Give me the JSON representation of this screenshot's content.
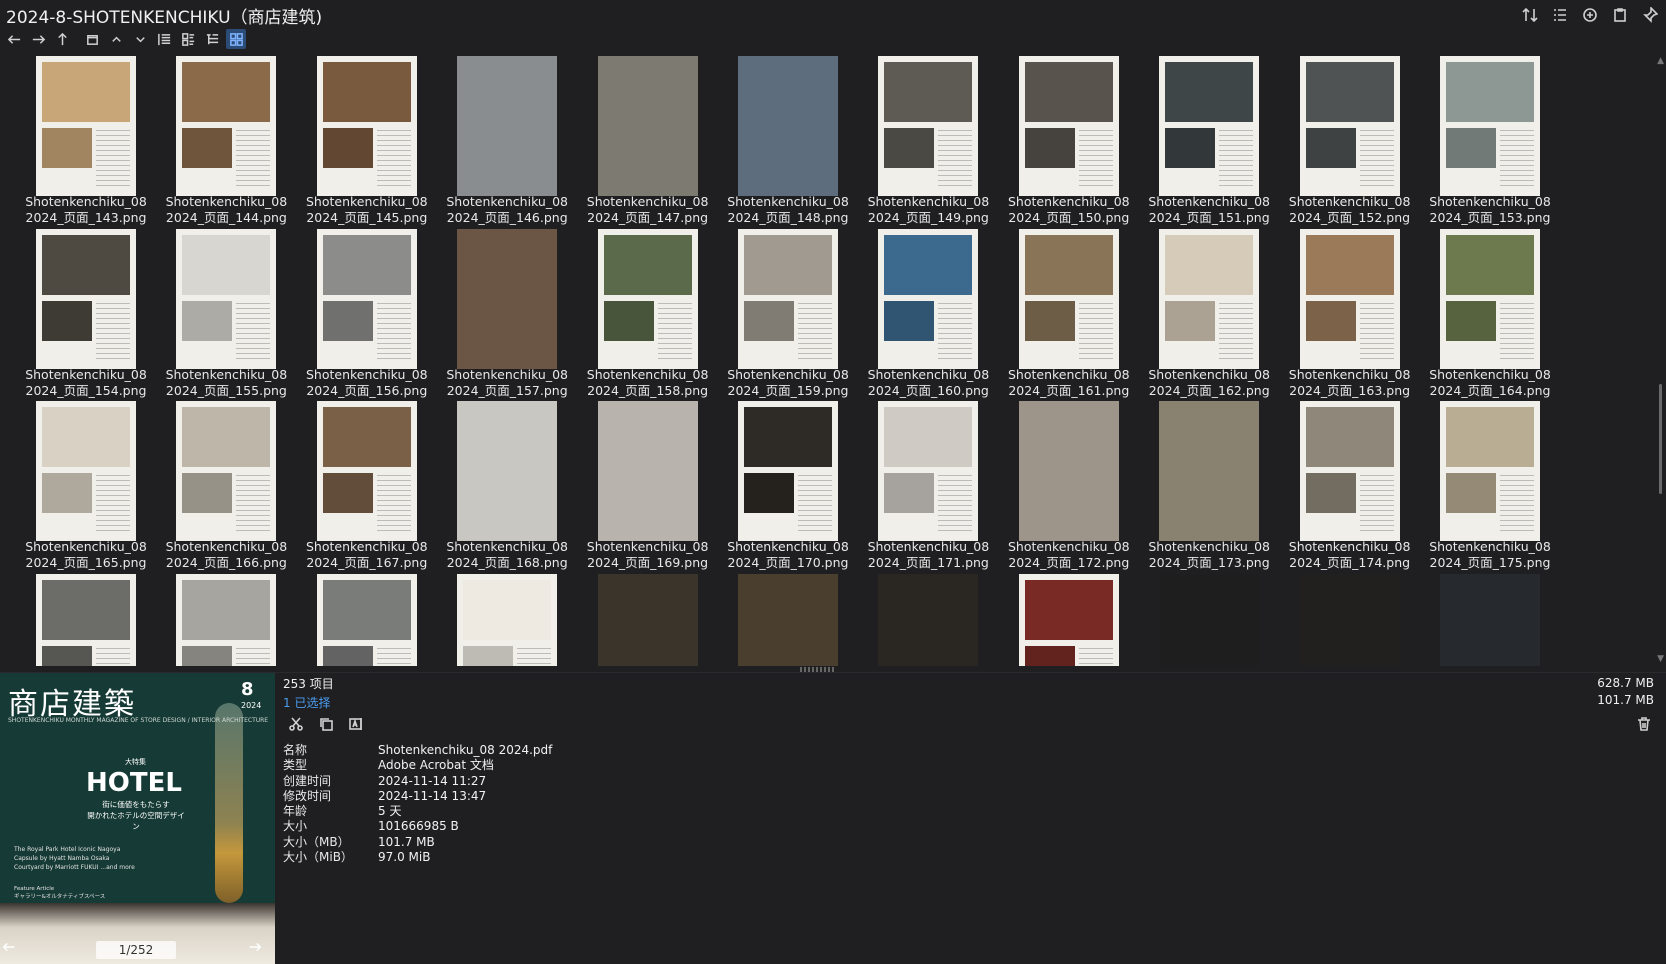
{
  "window": {
    "title": "2024-8-SHOTENKENCHIKU（商店建筑)"
  },
  "top_actions": [
    {
      "name": "sort-icon"
    },
    {
      "name": "list-view-icon"
    },
    {
      "name": "add-icon"
    },
    {
      "name": "clipboard-icon"
    },
    {
      "name": "pin-icon"
    }
  ],
  "toolbar": [
    {
      "name": "back-icon"
    },
    {
      "name": "forward-icon"
    },
    {
      "name": "up-icon"
    },
    {
      "name": "window-icon"
    },
    {
      "name": "sort-up-icon"
    },
    {
      "name": "sort-down-icon"
    },
    {
      "name": "detail-list-icon"
    },
    {
      "name": "tiles-icon"
    },
    {
      "name": "tree-list-icon"
    },
    {
      "name": "grid-view-icon"
    }
  ],
  "files": [
    {
      "line1": "Shotenkenchiku_08",
      "line2": "2024_页面_143.png",
      "tone": "#c8a678",
      "full": false
    },
    {
      "line1": "Shotenkenchiku_08",
      "line2": "2024_页面_144.png",
      "tone": "#8b6a4a",
      "full": false
    },
    {
      "line1": "Shotenkenchiku_08",
      "line2": "2024_页面_145.png",
      "tone": "#7a5a3e",
      "full": false
    },
    {
      "line1": "Shotenkenchiku_08",
      "line2": "2024_页面_146.png",
      "tone": "#8a8d8f",
      "full": true
    },
    {
      "line1": "Shotenkenchiku_08",
      "line2": "2024_页面_147.png",
      "tone": "#7d7a72",
      "full": true
    },
    {
      "line1": "Shotenkenchiku_08",
      "line2": "2024_页面_148.png",
      "tone": "#5d6d7e",
      "full": true
    },
    {
      "line1": "Shotenkenchiku_08",
      "line2": "2024_页面_149.png",
      "tone": "#5e5b54",
      "full": false
    },
    {
      "line1": "Shotenkenchiku_08",
      "line2": "2024_页面_150.png",
      "tone": "#58534c",
      "full": false
    },
    {
      "line1": "Shotenkenchiku_08",
      "line2": "2024_页面_151.png",
      "tone": "#3e4648",
      "full": false
    },
    {
      "line1": "Shotenkenchiku_08",
      "line2": "2024_页面_152.png",
      "tone": "#4f5353",
      "full": false
    },
    {
      "line1": "Shotenkenchiku_08",
      "line2": "2024_页面_153.png",
      "tone": "#8d9894",
      "full": false
    },
    {
      "line1": "Shotenkenchiku_08",
      "line2": "2024_页面_154.png",
      "tone": "#4e4a42",
      "full": false
    },
    {
      "line1": "Shotenkenchiku_08",
      "line2": "2024_页面_155.png",
      "tone": "#d8d6d0",
      "full": false
    },
    {
      "line1": "Shotenkenchiku_08",
      "line2": "2024_页面_156.png",
      "tone": "#8c8d8b",
      "full": false
    },
    {
      "line1": "Shotenkenchiku_08",
      "line2": "2024_页面_157.png",
      "tone": "#6b5646",
      "full": true
    },
    {
      "line1": "Shotenkenchiku_08",
      "line2": "2024_页面_158.png",
      "tone": "#5a6a4a",
      "full": false
    },
    {
      "line1": "Shotenkenchiku_08",
      "line2": "2024_页面_159.png",
      "tone": "#a09a90",
      "full": false
    },
    {
      "line1": "Shotenkenchiku_08",
      "line2": "2024_页面_160.png",
      "tone": "#3b6a8e",
      "full": false
    },
    {
      "line1": "Shotenkenchiku_08",
      "line2": "2024_页面_161.png",
      "tone": "#8a7458",
      "full": false
    },
    {
      "line1": "Shotenkenchiku_08",
      "line2": "2024_页面_162.png",
      "tone": "#d6cbb8",
      "full": false
    },
    {
      "line1": "Shotenkenchiku_08",
      "line2": "2024_页面_163.png",
      "tone": "#9b7a5a",
      "full": false
    },
    {
      "line1": "Shotenkenchiku_08",
      "line2": "2024_页面_164.png",
      "tone": "#6d7a4e",
      "full": false
    },
    {
      "line1": "Shotenkenchiku_08",
      "line2": "2024_页面_165.png",
      "tone": "#d9d2c4",
      "full": false
    },
    {
      "line1": "Shotenkenchiku_08",
      "line2": "2024_页面_166.png",
      "tone": "#bdb6a9",
      "full": false
    },
    {
      "line1": "Shotenkenchiku_08",
      "line2": "2024_页面_167.png",
      "tone": "#7b6048",
      "full": false
    },
    {
      "line1": "Shotenkenchiku_08",
      "line2": "2024_页面_168.png",
      "tone": "#c9c7c2",
      "full": true
    },
    {
      "line1": "Shotenkenchiku_08",
      "line2": "2024_页面_169.png",
      "tone": "#b8b4ad",
      "full": true
    },
    {
      "line1": "Shotenkenchiku_08",
      "line2": "2024_页面_170.png",
      "tone": "#2e2a26",
      "full": false
    },
    {
      "line1": "Shotenkenchiku_08",
      "line2": "2024_页面_171.png",
      "tone": "#cfcbc4",
      "full": false
    },
    {
      "line1": "Shotenkenchiku_08",
      "line2": "2024_页面_172.png",
      "tone": "#9d958a",
      "full": true
    },
    {
      "line1": "Shotenkenchiku_08",
      "line2": "2024_页面_173.png",
      "tone": "#8a8270",
      "full": true
    },
    {
      "line1": "Shotenkenchiku_08",
      "line2": "2024_页面_174.png",
      "tone": "#8f8779",
      "full": false
    },
    {
      "line1": "Shotenkenchiku_08",
      "line2": "2024_页面_175.png",
      "tone": "#b9ad93",
      "full": false
    },
    {
      "line1": "",
      "line2": "",
      "tone": "#6c6d68",
      "full": false
    },
    {
      "line1": "",
      "line2": "",
      "tone": "#a6a59f",
      "full": false
    },
    {
      "line1": "",
      "line2": "",
      "tone": "#7a7c7a",
      "full": false
    },
    {
      "line1": "",
      "line2": "",
      "tone": "#eeeae2",
      "full": false
    },
    {
      "line1": "",
      "line2": "",
      "tone": "#3a342a",
      "full": true
    },
    {
      "line1": "",
      "line2": "",
      "tone": "#4a3e2e",
      "full": true
    },
    {
      "line1": "",
      "line2": "",
      "tone": "#2a2622",
      "full": true
    },
    {
      "line1": "",
      "line2": "",
      "tone": "#7a2a24",
      "full": false
    },
    {
      "line1": "",
      "line2": "",
      "tone": "#1e1e1e",
      "full": true
    },
    {
      "line1": "",
      "line2": "",
      "tone": "#22201e",
      "full": true
    },
    {
      "line1": "",
      "line2": "",
      "tone": "#26292e",
      "full": true
    }
  ],
  "preview": {
    "cover_title": "商店建築",
    "cover_issue": "8",
    "cover_year": "2024",
    "cover_subtitle": "SHOTENKENCHIKU  MONTHLY MAGAZINE OF STORE DESIGN / INTERIOR ARCHITECTURE",
    "cover_special": "大特集",
    "cover_headline": "HOTEL",
    "cover_desc": "街に価値をもたらす\n開かれたホテルの空間デザイン",
    "cover_credits": "The Royal Park Hotel Iconic Nagoya\nCapsule by Hyatt Namba Osaka\nCourtyard by Marriott FUKUI ...and more",
    "cover_feature": "Feature Article\nギャラリー&オルタナティブスペース",
    "page_indicator": "1/252"
  },
  "info": {
    "item_count": "253 项目",
    "selected_count": "1 已选择",
    "total_size": "628.7 MB",
    "selected_size": "101.7 MB",
    "properties": [
      {
        "key": "名称",
        "value": "Shotenkenchiku_08 2024.pdf"
      },
      {
        "key": "类型",
        "value": "Adobe Acrobat 文档"
      },
      {
        "key": "创建时间",
        "value": "2024-11-14  11:27"
      },
      {
        "key": "修改时间",
        "value": "2024-11-14  13:47"
      },
      {
        "key": "年龄",
        "value": "5 天"
      },
      {
        "key": "大小",
        "value": "101666985 B"
      },
      {
        "key": "大小（MB）",
        "value": "101.7 MB"
      },
      {
        "key": "大小（MiB）",
        "value": "97.0 MiB"
      }
    ]
  },
  "colors": {
    "background": "#1f1f22",
    "accent": "#4a9df0",
    "active_view": "#2c4c78"
  }
}
